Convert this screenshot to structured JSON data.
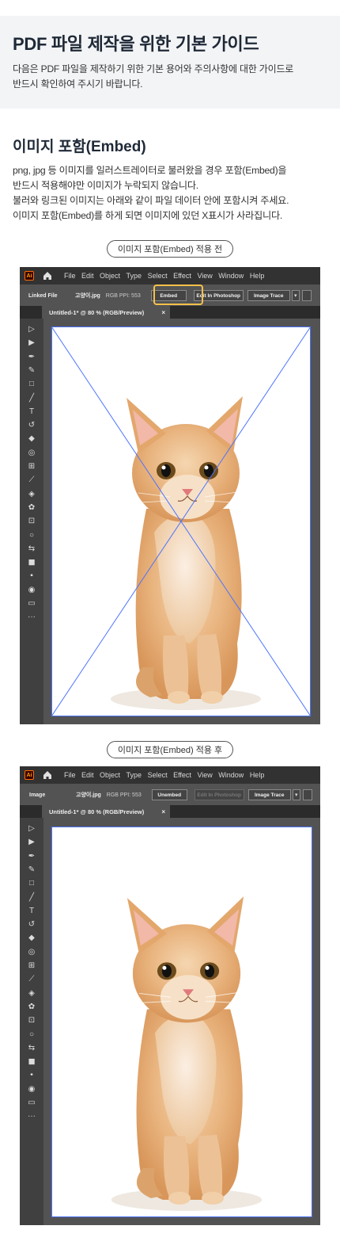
{
  "header": {
    "title": "PDF 파일 제작을 위한 기본 가이드",
    "subtitle_line1": "다음은 PDF 파일을 제작하기 위한 기본 용어와 주의사항에 대한 가이드로",
    "subtitle_line2": "반드시 확인하여 주시기 바랍니다."
  },
  "section": {
    "title": "이미지 포함(Embed)",
    "desc_line1": "png, jpg 등 이미지를 일러스트레이터로 불러왔을 경우 포함(Embed)을",
    "desc_line2": "반드시 적용해야만 이미지가 누락되지 않습니다.",
    "desc_line3": "불러와 링크된 이미지는 아래와 같이 파일 데이터 안에 포함시켜 주세요.",
    "desc_line4": "이미지 포함(Embed)를 하게 되면 이미지에 있던 X표시가 사라집니다."
  },
  "before": {
    "pill": "이미지 포함(Embed) 적용 전",
    "ai_logo": "Ai",
    "menus": [
      "File",
      "Edit",
      "Object",
      "Type",
      "Select",
      "Effect",
      "View",
      "Window",
      "Help"
    ],
    "ctrl_label": "Linked File",
    "file_name": "고양이.jpg",
    "file_meta": "RGB   PPI: 553",
    "btn_embed": "Embed",
    "btn_edit": "Edit In Photoshop",
    "btn_trace": "Image Trace",
    "caret": "▾",
    "tab_title": "Untitled-1* @ 80 % (RGB/Preview)",
    "tab_close": "×"
  },
  "after": {
    "pill": "이미지 포함(Embed) 적용 후",
    "ai_logo": "Ai",
    "menus": [
      "File",
      "Edit",
      "Object",
      "Type",
      "Select",
      "Effect",
      "View",
      "Window",
      "Help"
    ],
    "ctrl_label": "Image",
    "file_name": "고양이.jpg",
    "file_meta": "RGB   PPI: 553",
    "btn_unembed": "Unembed",
    "btn_edit": "Edit In Photoshop",
    "btn_trace": "Image Trace",
    "caret": "▾",
    "tab_title": "Untitled-1* @ 80 % (RGB/Preview)",
    "tab_close": "×"
  },
  "colors": {
    "accent_highlight": "#f5c04a",
    "selection_blue": "#4b73ff",
    "ui_dark": "#323232",
    "ui_mid": "#535353"
  },
  "icons": [
    "ai-logo-icon",
    "home-icon",
    "selection-tool-icon",
    "direct-selection-tool-icon",
    "pen-tool-icon",
    "curvature-tool-icon",
    "rectangle-tool-icon",
    "brush-tool-icon",
    "type-tool-icon",
    "rotate-tool-icon",
    "eraser-tool-icon",
    "warp-tool-icon",
    "shape-builder-icon",
    "eyedropper-icon",
    "blend-tool-icon",
    "symbol-sprayer-icon",
    "artboard-tool-icon",
    "zoom-icon",
    "fill-stroke-icon",
    "more-tools-icon"
  ]
}
